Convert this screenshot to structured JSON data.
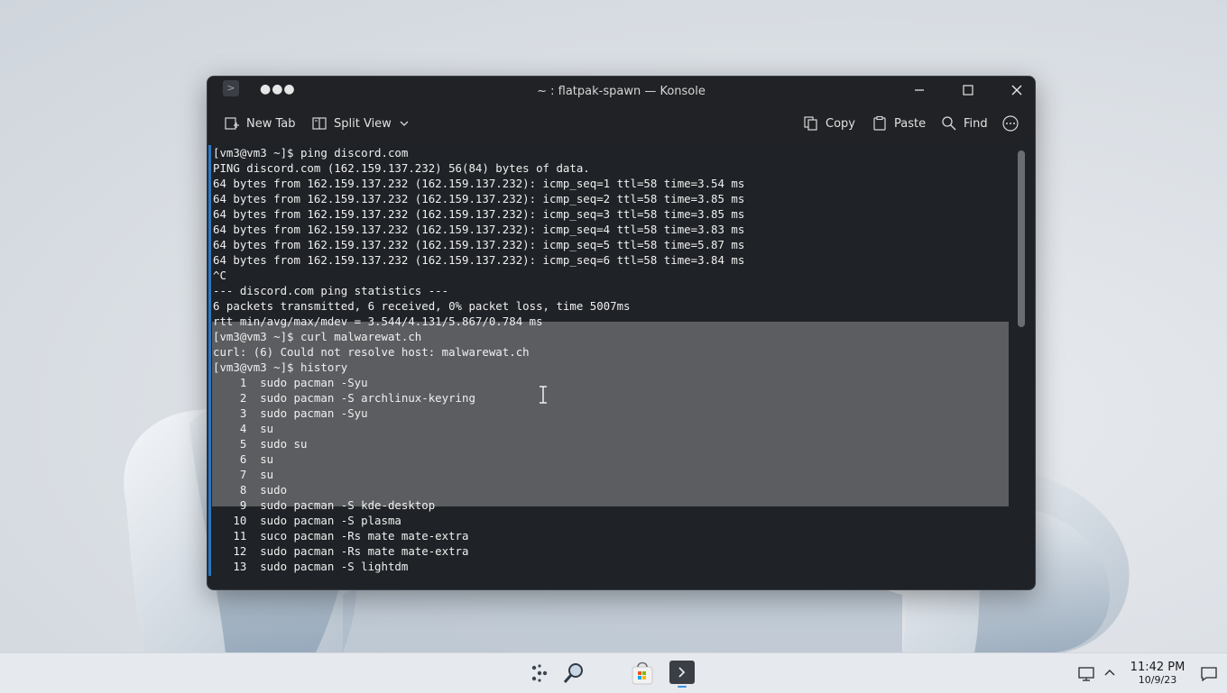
{
  "window": {
    "title": "~ : flatpak-spawn — Konsole",
    "menu_icon": "more-dots-icon"
  },
  "toolbar": {
    "new_tab": "New Tab",
    "split_view": "Split View",
    "copy": "Copy",
    "paste": "Paste",
    "find": "Find"
  },
  "terminal": {
    "lines": [
      "[vm3@vm3 ~]$ ping discord.com",
      "PING discord.com (162.159.137.232) 56(84) bytes of data.",
      "64 bytes from 162.159.137.232 (162.159.137.232): icmp_seq=1 ttl=58 time=3.54 ms",
      "64 bytes from 162.159.137.232 (162.159.137.232): icmp_seq=2 ttl=58 time=3.85 ms",
      "64 bytes from 162.159.137.232 (162.159.137.232): icmp_seq=3 ttl=58 time=3.85 ms",
      "64 bytes from 162.159.137.232 (162.159.137.232): icmp_seq=4 ttl=58 time=3.83 ms",
      "64 bytes from 162.159.137.232 (162.159.137.232): icmp_seq=5 ttl=58 time=5.87 ms",
      "64 bytes from 162.159.137.232 (162.159.137.232): icmp_seq=6 ttl=58 time=3.84 ms",
      "^C",
      "--- discord.com ping statistics ---",
      "6 packets transmitted, 6 received, 0% packet loss, time 5007ms",
      "rtt min/avg/max/mdev = 3.544/4.131/5.867/0.784 ms",
      "[vm3@vm3 ~]$ curl malwarewat.ch",
      "curl: (6) Could not resolve host: malwarewat.ch",
      "[vm3@vm3 ~]$ history",
      "    1  sudo pacman -Syu",
      "    2  sudo pacman -S archlinux-keyring",
      "    3  sudo pacman -Syu",
      "    4  su",
      "    5  sudo su",
      "    6  su",
      "    7  su",
      "    8  sudo",
      "    9  sudo pacman -S kde-desktop",
      "   10  sudo pacman -S plasma",
      "   11  suco pacman -Rs mate mate-extra",
      "   12  sudo pacman -Rs mate mate-extra",
      "   13  sudo pacman -S lightdm"
    ]
  },
  "taskbar": {
    "time": "11:42 PM",
    "date": "10/9/23"
  }
}
